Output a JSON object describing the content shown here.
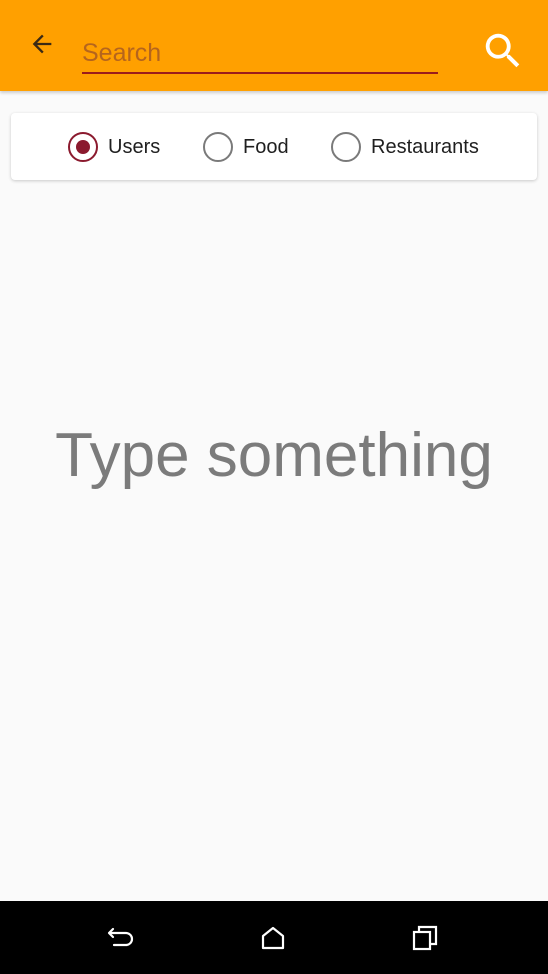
{
  "colors": {
    "appbar": "#ffa000",
    "accent": "#8b1a2e",
    "underline": "#9b1c1c",
    "background": "#fafafa",
    "empty_text": "#7b7b7b",
    "navbar": "#000000"
  },
  "appbar": {
    "back_icon": "arrow-left-icon",
    "search_placeholder": "Search",
    "search_value": "",
    "search_icon": "magnifier-icon"
  },
  "filters": {
    "options": [
      {
        "label": "Users",
        "checked": true
      },
      {
        "label": "Food",
        "checked": false
      },
      {
        "label": "Restaurants",
        "checked": false
      }
    ]
  },
  "empty_state": {
    "message": "Type something"
  },
  "navbar": {
    "back_icon": "nav-back-icon",
    "home_icon": "nav-home-icon",
    "recents_icon": "nav-recents-icon"
  }
}
